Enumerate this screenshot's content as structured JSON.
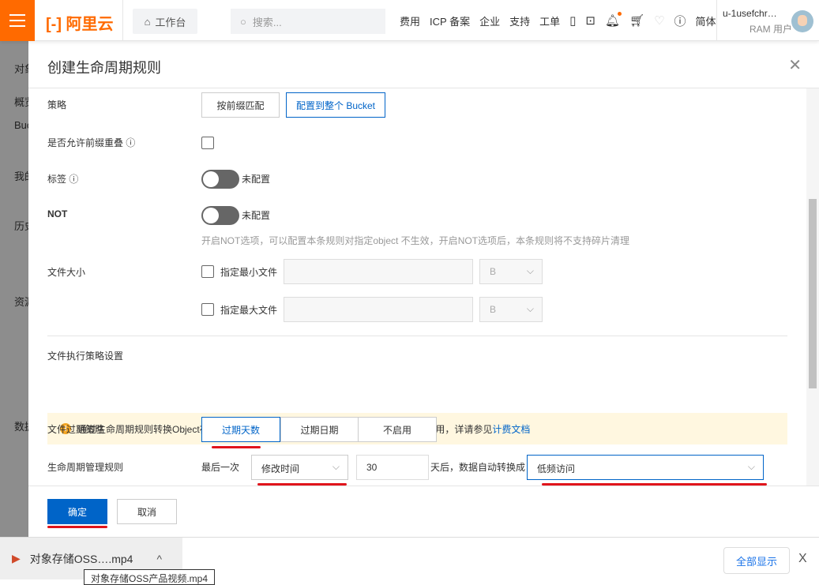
{
  "topbar": {
    "logo": "阿里云",
    "workbench": "工作台",
    "search_placeholder": "搜索...",
    "nav": [
      "费用",
      "ICP 备案",
      "企业",
      "支持",
      "工单"
    ],
    "lang": "简体",
    "username": "u-1usefchr…",
    "role": "RAM 用户"
  },
  "sidebar": {
    "items": [
      "对象",
      "概览",
      "Bucket",
      "我的",
      "历史",
      "资源",
      "数据"
    ]
  },
  "dialog": {
    "title": "创建生命周期规则",
    "strategy": {
      "label": "策略",
      "options": [
        "按前缀匹配",
        "配置到整个 Bucket"
      ],
      "selected": "配置到整个 Bucket"
    },
    "overlap": {
      "label": "是否允许前缀重叠",
      "checked": false
    },
    "tags": {
      "label": "标签",
      "state": "未配置",
      "enabled": false
    },
    "not": {
      "label": "NOT",
      "state": "未配置",
      "enabled": false,
      "hint": "开启NOT选项，可以配置本条规则对指定object 不生效，开启NOT选项后，本条规则将不支持碎片清理"
    },
    "filesize": {
      "label": "文件大小",
      "min_label": "指定最小文件",
      "max_label": "指定最大文件",
      "min_unit": "B",
      "max_unit": "B"
    },
    "section": "文件执行策略设置",
    "alert": {
      "text": "通过生命周期规则转换Object存储类型或者删除Object时可能涉及到请求费用和存储费用，详请参见",
      "link": "计费文档"
    },
    "expire": {
      "label": "文件过期策略",
      "options": [
        "过期天数",
        "过期日期",
        "不启用"
      ],
      "selected": "过期天数"
    },
    "rule": {
      "label": "生命周期管理规则",
      "prefix": "最后一次",
      "time_type": "修改时间",
      "days": "30",
      "middle": "天后，数据自动转换成",
      "storage_class": "低频访问"
    },
    "ok": "确定",
    "cancel": "取消"
  },
  "downloads": {
    "file": "对象存储OSS….mp4",
    "tooltip": "对象存储OSS产品视频.mp4",
    "show_all": "全部显示",
    "close": "X"
  },
  "colors": {
    "brand": "#ff6a00",
    "primary": "#0064c8",
    "annotation": "#e0141b"
  }
}
